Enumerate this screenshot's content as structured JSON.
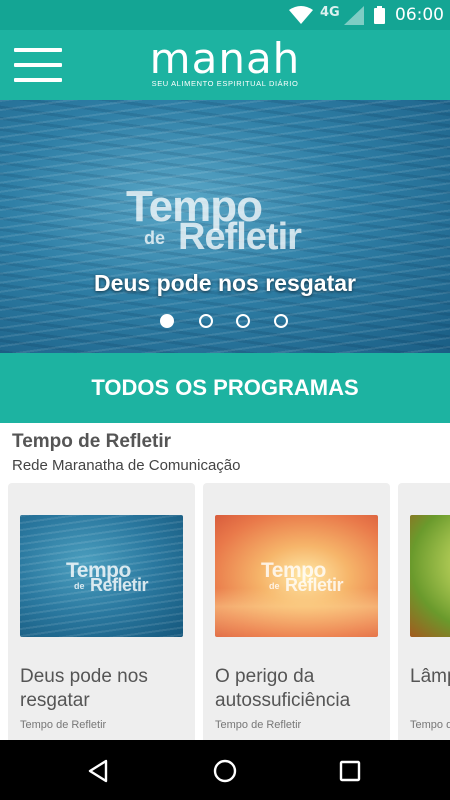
{
  "status_bar": {
    "network": "4G",
    "time": "06:00",
    "icons": [
      "wifi-icon",
      "signal-icon",
      "battery-icon"
    ]
  },
  "app_bar": {
    "logo_word": "manah",
    "logo_tagline": "SEU ALIMENTO ESPIRITUAL DIÁRIO",
    "menu_icon": "hamburger-menu-icon"
  },
  "hero": {
    "logo_line1": "Tempo",
    "logo_line2": "de",
    "logo_line3": "Refletir",
    "title": "Deus pode nos resgatar",
    "slide_count": 4,
    "active_slide": 1
  },
  "programs_button": "TODOS OS PROGRAMAS",
  "section": {
    "title": "Tempo de Refletir",
    "subtitle": "Rede Maranatha de Comunicação",
    "cards": [
      {
        "title": "Deus pode nos\nresgatar",
        "source": "Tempo de Refletir",
        "thumb_logo1": "Tempo",
        "thumb_logo2": "de",
        "thumb_logo3": "Refletir"
      },
      {
        "title": "O perigo da\nautossuficiência",
        "source": "Tempo de Refletir",
        "thumb_logo1": "Tempo",
        "thumb_logo2": "de",
        "thumb_logo3": "Refletir"
      },
      {
        "title": "Lâmp",
        "source": "Tempo de"
      }
    ]
  },
  "nav_bar": {
    "icons": [
      "back-icon",
      "home-icon",
      "recents-icon"
    ]
  },
  "colors": {
    "status_bar": "#14a594",
    "accent": "#1db3a1",
    "card_background": "#eeeeee"
  }
}
